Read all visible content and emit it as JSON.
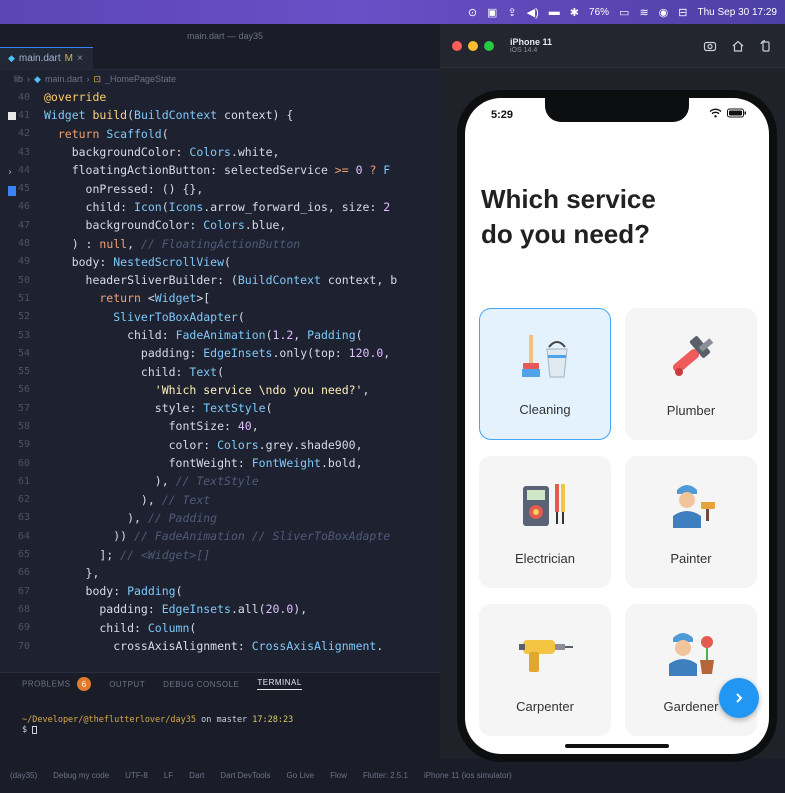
{
  "menubar": {
    "battery": "76%",
    "datetime": "Thu Sep 30  17:29"
  },
  "vscode": {
    "window_title": "main.dart — day35",
    "tab": {
      "label": "main.dart",
      "status": "M"
    },
    "breadcrumb": [
      "lib",
      "main.dart",
      "_HomePageState"
    ],
    "code_lines": [
      {
        "n": "40",
        "tokens": [
          [
            "ann",
            "@override"
          ]
        ]
      },
      {
        "n": "41",
        "tokens": [
          [
            "ty",
            "Widget "
          ],
          [
            "fn",
            "build"
          ],
          [
            "pr",
            "("
          ],
          [
            "ty",
            "BuildContext"
          ],
          [
            "pr",
            " context) {"
          ]
        ]
      },
      {
        "n": "42",
        "tokens": [
          [
            "kw",
            "  return "
          ],
          [
            "ty",
            "Scaffold"
          ],
          [
            "pr",
            "("
          ]
        ]
      },
      {
        "n": "43",
        "tokens": [
          [
            "pr",
            "    backgroundColor: "
          ],
          [
            "ty",
            "Colors"
          ],
          [
            "pr",
            ".white,"
          ]
        ]
      },
      {
        "n": "44",
        "tokens": [
          [
            "pr",
            "    floatingActionButton: selectedService "
          ],
          [
            "op",
            ">="
          ],
          [
            "num",
            " 0"
          ],
          [
            "op",
            " ? "
          ],
          [
            "ty",
            "F"
          ]
        ]
      },
      {
        "n": "45",
        "tokens": [
          [
            "pr",
            "      onPressed: () {},"
          ]
        ]
      },
      {
        "n": "46",
        "tokens": [
          [
            "pr",
            "      child: "
          ],
          [
            "ty",
            "Icon"
          ],
          [
            "pr",
            "("
          ],
          [
            "ty",
            "Icons"
          ],
          [
            "pr",
            ".arrow_forward_ios, size: "
          ],
          [
            "num",
            "2"
          ]
        ]
      },
      {
        "n": "47",
        "tokens": [
          [
            "pr",
            "      backgroundColor: "
          ],
          [
            "ty",
            "Colors"
          ],
          [
            "pr",
            ".blue,"
          ]
        ]
      },
      {
        "n": "48",
        "tokens": [
          [
            "pr",
            "    ) : "
          ],
          [
            "kw",
            "null"
          ],
          [
            "pr",
            ", "
          ],
          [
            "cm",
            "// FloatingActionButton"
          ]
        ]
      },
      {
        "n": "49",
        "tokens": [
          [
            "pr",
            "    body: "
          ],
          [
            "ty",
            "NestedScrollView"
          ],
          [
            "pr",
            "("
          ]
        ]
      },
      {
        "n": "50",
        "tokens": [
          [
            "pr",
            "      headerSliverBuilder: ("
          ],
          [
            "ty",
            "BuildContext"
          ],
          [
            "pr",
            " context, b"
          ]
        ]
      },
      {
        "n": "51",
        "tokens": [
          [
            "kw",
            "        return "
          ],
          [
            "pr",
            "<"
          ],
          [
            "ty",
            "Widget"
          ],
          [
            "pr",
            ">["
          ]
        ]
      },
      {
        "n": "52",
        "tokens": [
          [
            "ty",
            "          SliverToBoxAdapter"
          ],
          [
            "pr",
            "("
          ]
        ]
      },
      {
        "n": "53",
        "tokens": [
          [
            "pr",
            "            child: "
          ],
          [
            "ty",
            "FadeAnimation"
          ],
          [
            "pr",
            "("
          ],
          [
            "num",
            "1.2"
          ],
          [
            "pr",
            ", "
          ],
          [
            "ty",
            "Padding"
          ],
          [
            "pr",
            "("
          ]
        ]
      },
      {
        "n": "54",
        "tokens": [
          [
            "pr",
            "              padding: "
          ],
          [
            "ty",
            "EdgeInsets"
          ],
          [
            "pr",
            ".only(top: "
          ],
          [
            "num",
            "120.0"
          ],
          [
            "pr",
            ","
          ]
        ]
      },
      {
        "n": "55",
        "tokens": [
          [
            "pr",
            "              child: "
          ],
          [
            "ty",
            "Text"
          ],
          [
            "pr",
            "("
          ]
        ]
      },
      {
        "n": "56",
        "tokens": [
          [
            "str",
            "                'Which service \\ndo you need?'"
          ],
          [
            "pr",
            ","
          ]
        ]
      },
      {
        "n": "57",
        "tokens": [
          [
            "pr",
            "                style: "
          ],
          [
            "ty",
            "TextStyle"
          ],
          [
            "pr",
            "("
          ]
        ]
      },
      {
        "n": "58",
        "tokens": [
          [
            "pr",
            "                  fontSize: "
          ],
          [
            "num",
            "40"
          ],
          [
            "pr",
            ","
          ]
        ]
      },
      {
        "n": "59",
        "tokens": [
          [
            "pr",
            "                  color: "
          ],
          [
            "ty",
            "Colors"
          ],
          [
            "pr",
            ".grey.shade900,"
          ]
        ]
      },
      {
        "n": "60",
        "tokens": [
          [
            "pr",
            "                  fontWeight: "
          ],
          [
            "ty",
            "FontWeight"
          ],
          [
            "pr",
            ".bold,"
          ]
        ]
      },
      {
        "n": "61",
        "tokens": [
          [
            "pr",
            "                ), "
          ],
          [
            "cm",
            "// TextStyle"
          ]
        ]
      },
      {
        "n": "62",
        "tokens": [
          [
            "pr",
            "              ), "
          ],
          [
            "cm",
            "// Text"
          ]
        ]
      },
      {
        "n": "63",
        "tokens": [
          [
            "pr",
            "            ), "
          ],
          [
            "cm",
            "// Padding"
          ]
        ]
      },
      {
        "n": "64",
        "tokens": [
          [
            "pr",
            "          )) "
          ],
          [
            "cm",
            "// FadeAnimation // SliverToBoxAdapte"
          ]
        ]
      },
      {
        "n": "65",
        "tokens": [
          [
            "pr",
            "        ]; "
          ],
          [
            "cm",
            "// <Widget>[]"
          ]
        ]
      },
      {
        "n": "66",
        "tokens": [
          [
            "pr",
            "      },"
          ]
        ]
      },
      {
        "n": "67",
        "tokens": [
          [
            "pr",
            "      body: "
          ],
          [
            "ty",
            "Padding"
          ],
          [
            "pr",
            "("
          ]
        ]
      },
      {
        "n": "68",
        "tokens": [
          [
            "pr",
            "        padding: "
          ],
          [
            "ty",
            "EdgeInsets"
          ],
          [
            "pr",
            ".all("
          ],
          [
            "num",
            "20.0"
          ],
          [
            "pr",
            "),"
          ]
        ]
      },
      {
        "n": "69",
        "tokens": [
          [
            "pr",
            "        child: "
          ],
          [
            "ty",
            "Column"
          ],
          [
            "pr",
            "("
          ]
        ]
      },
      {
        "n": "70",
        "tokens": [
          [
            "pr",
            "          crossAxisAlignment: "
          ],
          [
            "ty",
            "CrossAxisAlignment"
          ],
          [
            "pr",
            "."
          ]
        ]
      }
    ],
    "panel": {
      "tabs": [
        "PROBLEMS",
        "OUTPUT",
        "DEBUG CONSOLE",
        "TERMINAL"
      ],
      "problems_count": "6",
      "terminal_path": "~/Developer/@theflutterlover/day35",
      "terminal_branch": " on  master ",
      "terminal_time": "17:28:23",
      "terminal_prompt": "$ "
    },
    "statusbar": [
      "(day35)",
      "Debug my code",
      "UTF-8",
      "LF",
      "Dart",
      "Dart DevTools",
      "Go Live",
      "Flow",
      "Flutter: 2.5.1",
      "iPhone 11 (ios simulator)"
    ]
  },
  "simulator": {
    "device": "iPhone 11",
    "os": "iOS 14.4"
  },
  "app": {
    "status_time": "5:29",
    "headline": "Which service\ndo you need?",
    "services": [
      {
        "label": "Cleaning",
        "icon": "cleaning-icon",
        "selected": true
      },
      {
        "label": "Plumber",
        "icon": "plumber-icon",
        "selected": false
      },
      {
        "label": "Electrician",
        "icon": "electrician-icon",
        "selected": false
      },
      {
        "label": "Painter",
        "icon": "painter-icon",
        "selected": false
      },
      {
        "label": "Carpenter",
        "icon": "carpenter-icon",
        "selected": false
      },
      {
        "label": "Gardener",
        "icon": "gardener-icon",
        "selected": false
      }
    ],
    "accent_color": "#2196f3"
  }
}
